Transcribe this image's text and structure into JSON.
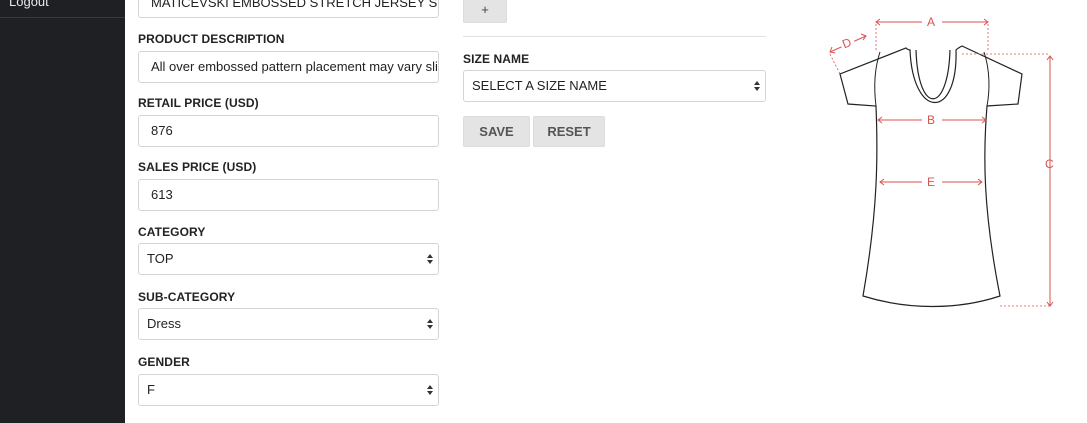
{
  "sidebar": {
    "logout_label": "Logout"
  },
  "form": {
    "product_name_value": "MATICEVSKI EMBOSSED STRETCH JERSEY SWEA",
    "product_description": {
      "label": "PRODUCT DESCRIPTION",
      "value": "All over embossed pattern placement may vary sligh"
    },
    "retail_price": {
      "label": "RETAIL PRICE (USD)",
      "value": "876"
    },
    "sales_price": {
      "label": "SALES PRICE (USD)",
      "value": "613"
    },
    "category": {
      "label": "CATEGORY",
      "value": "TOP"
    },
    "sub_category": {
      "label": "SUB-CATEGORY",
      "value": "Dress"
    },
    "gender": {
      "label": "GENDER",
      "value": "F"
    }
  },
  "sizes": {
    "add_label": "+",
    "size_name": {
      "label": "SIZE NAME",
      "value": "SELECT A SIZE NAME"
    },
    "save_label": "SAVE",
    "reset_label": "RESET"
  },
  "size_chart": {
    "measure_a": "A",
    "measure_b": "B",
    "measure_c": "C",
    "measure_d": "D",
    "measure_e": "E",
    "accent_color": "#d9534f"
  }
}
